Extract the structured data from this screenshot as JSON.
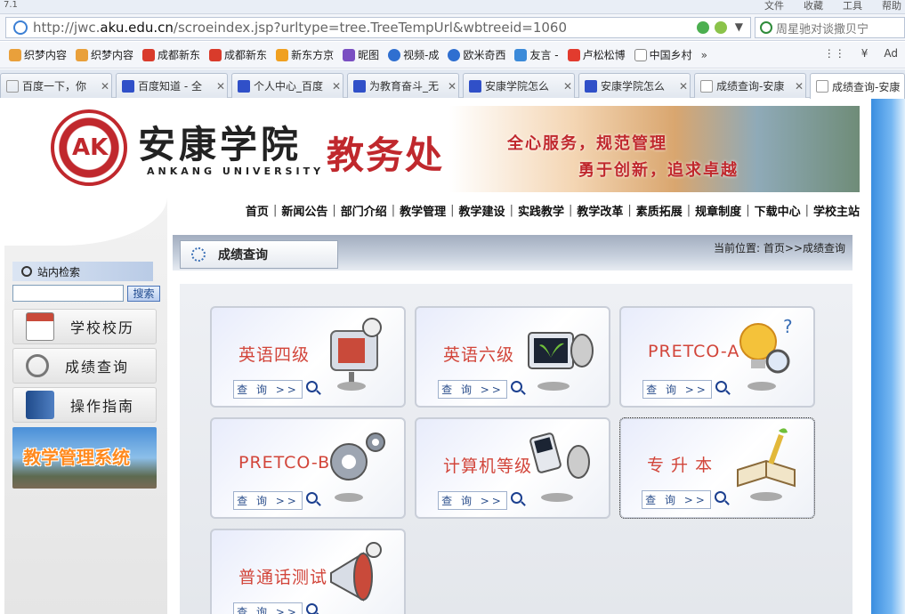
{
  "browser": {
    "version": "7.1",
    "menus": [
      "文件",
      "收藏",
      "工具",
      "帮助"
    ],
    "url_prefix": "http://jwc.",
    "url_domain": "aku.edu.cn",
    "url_suffix": "/scroeindex.jsp?urltype=tree.TreeTempUrl&wbtreeid=1060",
    "search_text": "周星驰对谈撒贝宁",
    "favorites": [
      "织梦内容",
      "织梦内容",
      "成都新东",
      "成都新东",
      "新东方京",
      "昵图",
      "视频-成",
      "欧米奇西",
      "友言 -",
      "卢松松博",
      "中国乡村"
    ],
    "fav_more": "»",
    "tabs": [
      {
        "label": "百度一下，你",
        "active": false
      },
      {
        "label": "百度知道 - 全",
        "active": false
      },
      {
        "label": "个人中心_百度",
        "active": false
      },
      {
        "label": "为教育奋斗_无",
        "active": false
      },
      {
        "label": "安康学院怎么",
        "active": false
      },
      {
        "label": "安康学院怎么",
        "active": false
      },
      {
        "label": "成绩查询-安康",
        "active": false
      },
      {
        "label": "成绩查询-安康",
        "active": true
      }
    ],
    "colors": {
      "accent": "#c0282d",
      "link": "#2c4f8c"
    }
  },
  "banner": {
    "logo_letters": "AK",
    "school_cn": "安康学院",
    "school_en": "ANKANG UNIVERSITY",
    "office": "教务处",
    "slogan1": "全心服务，规范管理",
    "slogan2": "勇于创新，追求卓越"
  },
  "nav": [
    "首页",
    "新闻公告",
    "部门介绍",
    "教学管理",
    "教学建设",
    "实践教学",
    "教学改革",
    "素质拓展",
    "规章制度",
    "下载中心",
    "学校主站"
  ],
  "nav_sep": "|",
  "sidebar": {
    "search_title": "站内检索",
    "search_button": "搜索",
    "items": [
      {
        "label": "学校校历",
        "icon": "calendar-icon"
      },
      {
        "label": "成绩查询",
        "icon": "magnifier-icon"
      },
      {
        "label": "操作指南",
        "icon": "book-icon"
      }
    ],
    "system_banner": "教学管理系统"
  },
  "main": {
    "section_title": "成绩查询",
    "location": "当前位置: 首页>>成绩查询",
    "query_label": "查 询 >>",
    "cards": [
      {
        "title": "英语四级",
        "icon": "projector-icon"
      },
      {
        "title": "英语六级",
        "icon": "monitor-plant-icon"
      },
      {
        "title": "PRETCO-A",
        "icon": "lightbulb-icon"
      },
      {
        "title": "PRETCO-B",
        "icon": "gears-icon"
      },
      {
        "title": "计算机等级",
        "icon": "phone-satellite-icon"
      },
      {
        "title": "专 升 本",
        "icon": "open-book-icon"
      },
      {
        "title": "普通话测试",
        "icon": "megaphone-icon"
      }
    ]
  }
}
